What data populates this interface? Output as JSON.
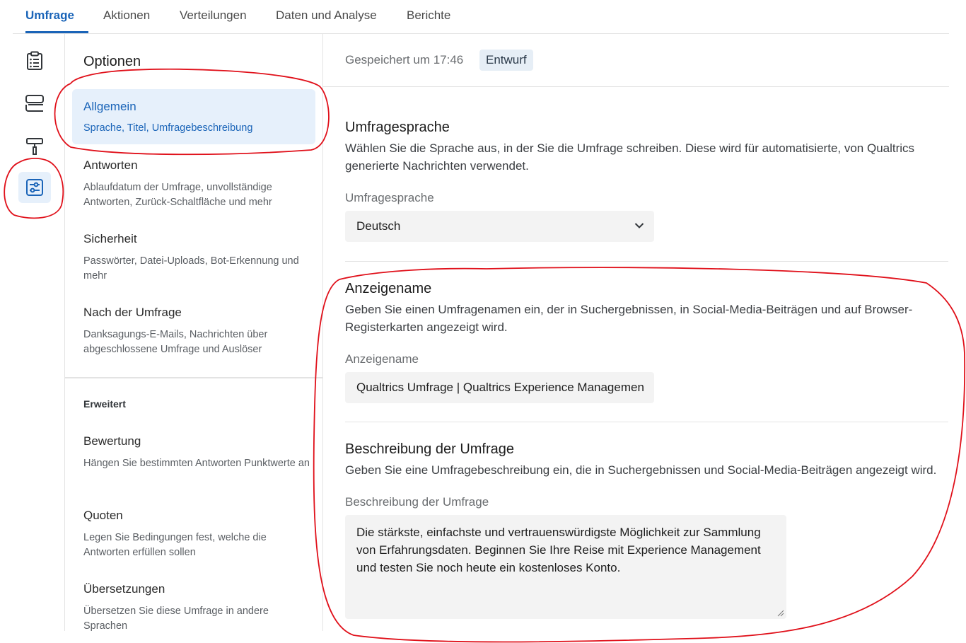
{
  "tabs": [
    {
      "label": "Umfrage",
      "active": true
    },
    {
      "label": "Aktionen"
    },
    {
      "label": "Verteilungen"
    },
    {
      "label": "Daten und Analyse"
    },
    {
      "label": "Berichte"
    }
  ],
  "options": {
    "title": "Optionen",
    "items": [
      {
        "label": "Allgemein",
        "desc": "Sprache, Titel, Umfragebeschreibung",
        "active": true
      },
      {
        "label": "Antworten",
        "desc": "Ablaufdatum der Umfrage, unvollständige Antworten, Zurück-Schaltfläche und mehr"
      },
      {
        "label": "Sicherheit",
        "desc": "Passwörter, Datei-Uploads, Bot-Erkennung und mehr"
      },
      {
        "label": "Nach der Umfrage",
        "desc": "Danksagungs-E-Mails, Nachrichten über abgeschlossene Umfrage und Auslöser"
      }
    ],
    "advanced_title": "Erweitert",
    "advanced_items": [
      {
        "label": "Bewertung",
        "desc": "Hängen Sie bestimmten Antworten Punktwerte an"
      },
      {
        "label": "Quoten",
        "desc": "Legen Sie Bedingungen fest, welche die Antworten erfüllen sollen"
      },
      {
        "label": "Übersetzungen",
        "desc": "Übersetzen Sie diese Umfrage in andere Sprachen"
      }
    ]
  },
  "header": {
    "saved": "Gespeichert um 17:46",
    "status": "Entwurf"
  },
  "language": {
    "title": "Umfragesprache",
    "desc": "Wählen Sie die Sprache aus, in der Sie die Umfrage schreiben. Diese wird für automatisierte, von Qualtrics generierte Nachrichten verwendet.",
    "field_label": "Umfragesprache",
    "value": "Deutsch"
  },
  "display_name": {
    "title": "Anzeigename",
    "desc": "Geben Sie einen Umfragenamen ein, der in Suchergebnissen, in Social-Media-Beiträgen und auf Browser-Registerkarten angezeigt wird.",
    "field_label": "Anzeigename",
    "value": "Qualtrics Umfrage | Qualtrics Experience Management"
  },
  "description": {
    "title": "Beschreibung der Umfrage",
    "desc": "Geben Sie eine Umfragebeschreibung ein, die in Suchergebnissen und Social-Media-Beiträgen angezeigt wird.",
    "field_label": "Beschreibung der Umfrage",
    "value": "Die stärkste, einfachste und vertrauenswürdigste Möglichkeit zur Sammlung von Erfahrungsdaten. Beginnen Sie Ihre Reise mit Experience Management und testen Sie noch heute ein kostenloses Konto."
  },
  "colors": {
    "accent": "#1a64b8",
    "active_bg": "#e6f0fb",
    "annotation": "#e0101a"
  },
  "icons": [
    "survey-clipboard-icon",
    "layout-blocks-icon",
    "paint-roller-icon",
    "settings-sliders-icon",
    "chevron-down-icon"
  ]
}
